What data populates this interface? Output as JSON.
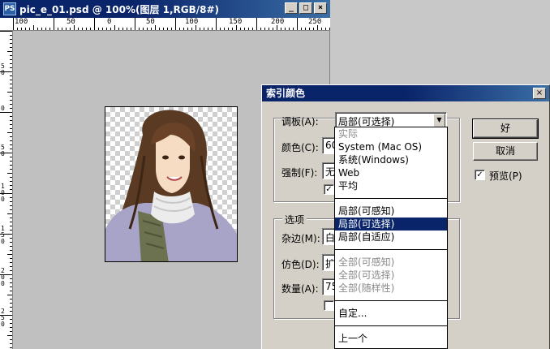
{
  "document_window": {
    "title": "pic_e_01.psd @ 100%(图层 1,RGB/8#)",
    "icon": "PS",
    "buttons": {
      "minimize": "_",
      "maximize": "□",
      "close": "×"
    },
    "ruler_top_labels": [
      "100",
      "50",
      "0",
      "50",
      "100",
      "150",
      "200",
      "250"
    ],
    "ruler_left_labels": [
      "5 0",
      "0",
      "5 0",
      "1 0 0",
      "1 5 0",
      "2 0 0",
      "2 5 0"
    ]
  },
  "dialog": {
    "title": "索引颜色",
    "close": "×",
    "palette": {
      "label": "调板(A):",
      "value": "局部(可选择)"
    },
    "colors": {
      "label": "颜色(C):",
      "value": "60"
    },
    "forced": {
      "label": "强制(F):",
      "value": "无"
    },
    "options_group": "选项",
    "matte": {
      "label": "杂边(M):",
      "value": "白"
    },
    "dither": {
      "label": "仿色(D):",
      "value": "扩"
    },
    "amount": {
      "label": "数量(A):",
      "value": "75"
    },
    "ok_button": "好",
    "cancel_button": "取消",
    "preview": {
      "label": "预览(P)",
      "checked": true
    },
    "check_glyph": "✓"
  },
  "dropdown": {
    "group1": [
      "实际",
      "System (Mac OS)",
      "系统(Windows)",
      "Web",
      "平均"
    ],
    "group2": [
      "局部(可感知)",
      "局部(可选择)",
      "局部(自适应)"
    ],
    "group3": [
      "全部(可感知)",
      "全部(可选择)",
      "全部(随样性)"
    ],
    "group4": [
      "自定..."
    ],
    "group5": [
      "上一个"
    ],
    "selected_item": "局部(可选择)"
  },
  "colors": {
    "title_active": "#0a246a",
    "selection": "#0a246a",
    "dialog_bg": "#d4d0c8"
  }
}
